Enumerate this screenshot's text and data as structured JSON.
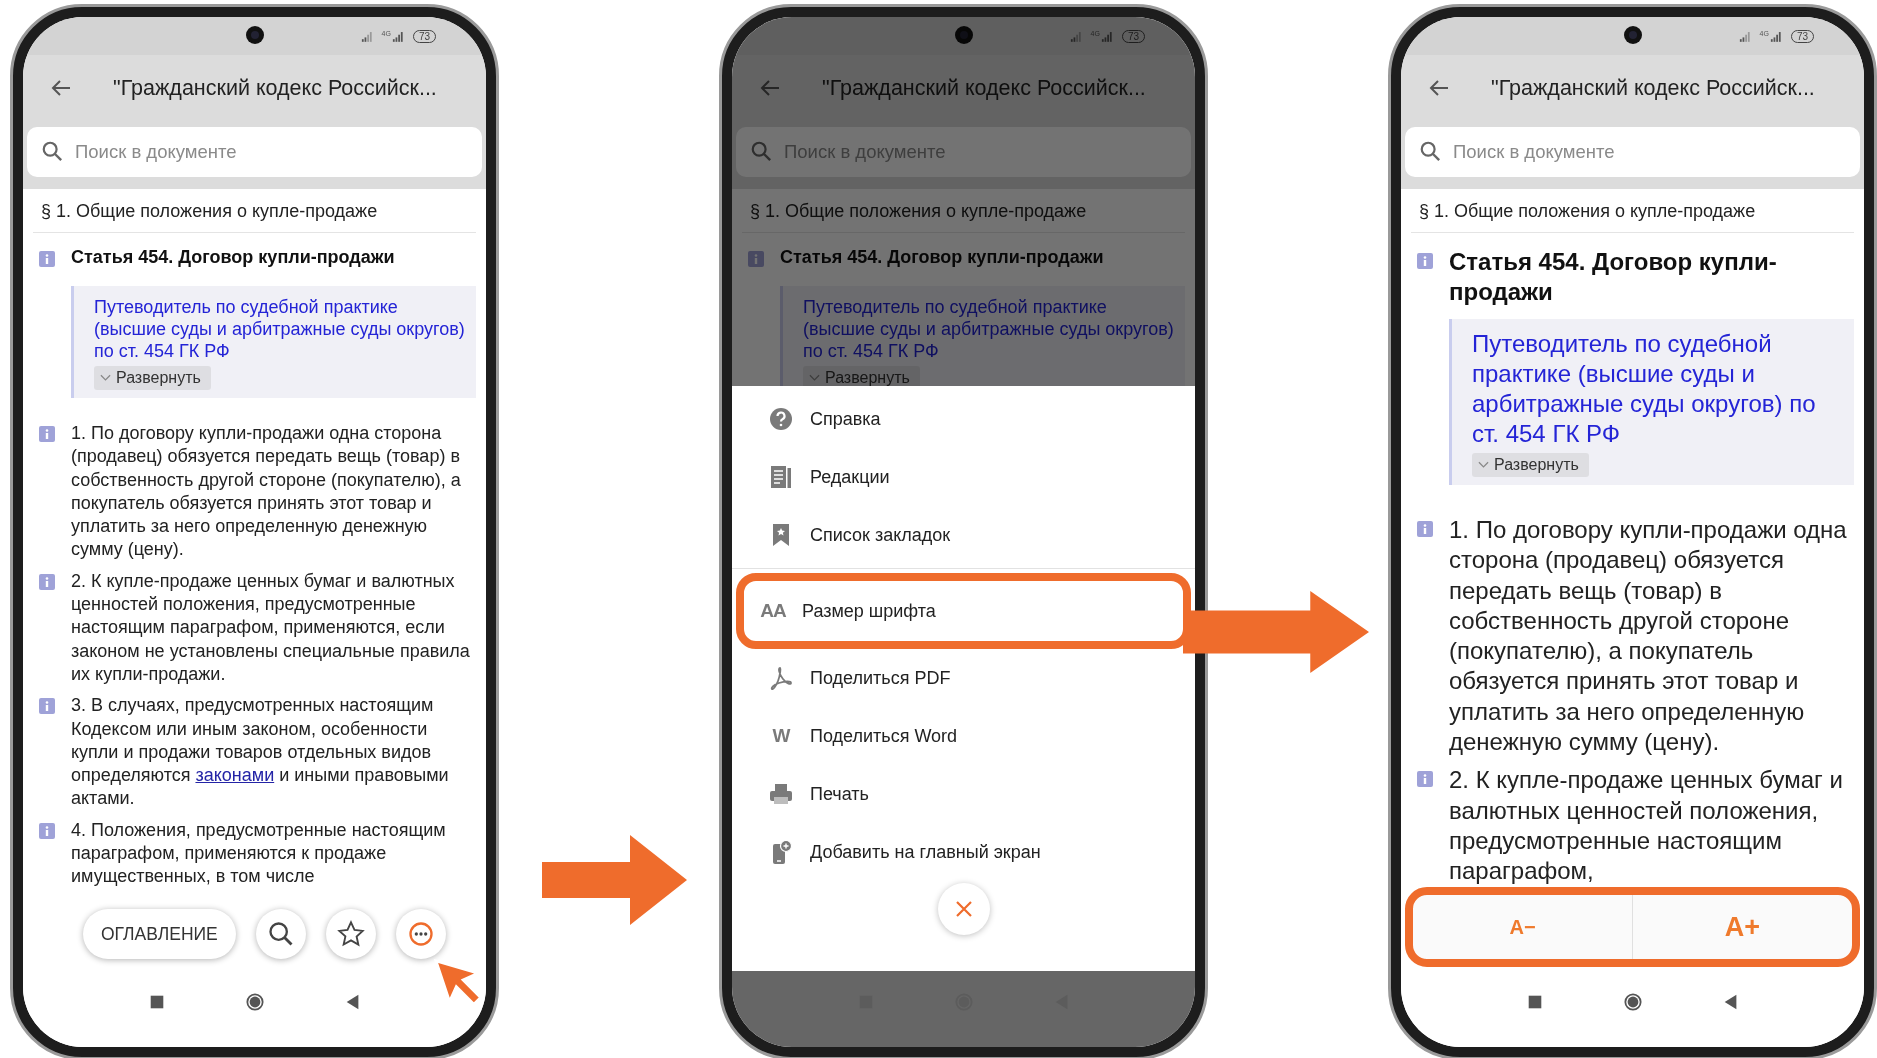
{
  "phones": [
    {
      "dimmed": false,
      "kind": "standard",
      "status_bar": {
        "network": "4G",
        "battery": "73"
      },
      "title": "\"Гражданский кодекс Российск...",
      "search": {
        "placeholder": "Поиск в документе"
      },
      "section": "§ 1. Общие положения о купле-продаже",
      "article": "Статья 454. Договор купли-продажи",
      "guide": {
        "text": "Путеводитель по судебной практике (высшие суды и арбитражные суды округов) по ст. 454 ГК РФ",
        "expand": "Развернуть"
      },
      "paragraphs": [
        {
          "text": "1. По договору купли-продажи одна сторона (продавец) обязуется передать вещь (товар) в собственность другой стороне (покупателю), а покупатель обязуется принять этот товар и уплатить за него определенную денежную сумму (цену)."
        },
        {
          "text": "2. К купле-продаже ценных бумаг и валютных ценностей положения, предусмотренные настоящим параграфом, применяются, если законом не установлены специальные правила их купли-продажи."
        },
        {
          "text": "3. В случаях, предусмотренных настоящим Кодексом или иным законом, особенности купли и продажи товаров отдельных видов определяются ",
          "link": "законами",
          "text_after": " и иными правовыми актами."
        },
        {
          "text": "4. Положения, предусмотренные настоящим параграфом, применяются к продаже имущественных, в том числе"
        }
      ],
      "toolbar": {
        "contents": "ОГЛАВЛЕНИЕ",
        "more_highlighted": true
      }
    },
    {
      "dimmed": true,
      "kind": "standard",
      "status_bar": {
        "network": "4G",
        "battery": "73"
      },
      "title": "\"Гражданский кодекс Российск...",
      "search": {
        "placeholder": "Поиск в документе"
      },
      "section": "§ 1. Общие положения о купле-продаже",
      "article": "Статья 454. Договор купли-продажи",
      "guide": {
        "text": "Путеводитель по судебной практике (высшие суды и арбитражные суды округов) по ст. 454 ГК РФ",
        "expand": "Развернуть"
      },
      "menu": {
        "groups": [
          [
            {
              "label": "Справка",
              "highlighted": false
            },
            {
              "label": "Редакции",
              "highlighted": false
            },
            {
              "label": "Список закладок",
              "highlighted": false
            }
          ],
          [
            {
              "glyph": "AA",
              "label": "Размер шрифта",
              "highlighted": true
            },
            {
              "label": "Поделиться PDF",
              "highlighted": false
            },
            {
              "glyph": "W",
              "label": "Поделиться Word",
              "highlighted": false
            },
            {
              "label": "Печать",
              "highlighted": false
            },
            {
              "label": "Добавить на главный экран",
              "highlighted": false
            }
          ]
        ]
      }
    },
    {
      "dimmed": false,
      "kind": "enlarged",
      "status_bar": {
        "network": "4G",
        "battery": "73"
      },
      "title": "\"Гражданский кодекс Российск...",
      "search": {
        "placeholder": "Поиск в документе"
      },
      "section": "§ 1. Общие положения о купле-продаже",
      "article": "Статья 454. Договор купли-продажи",
      "guide": {
        "text": "Путеводитель по судебной практике (высшие суды и арбитражные суды округов) по ст. 454 ГК РФ",
        "expand": "Развернуть"
      },
      "paragraphs": [
        {
          "text": "1. По договору купли-продажи одна сторона (продавец) обязуется передать вещь (товар) в собственность другой стороне (покупателю), а покупатель обязуется принять этот товар и уплатить за него определенную денежную сумму (цену)."
        },
        {
          "text": "2. К купле-продаже ценных бумаг и валютных ценностей положения, предусмотренные настоящим параграфом,"
        }
      ],
      "font_bar": {
        "decrease": "A−",
        "increase": "A+",
        "highlighted": true
      }
    }
  ]
}
